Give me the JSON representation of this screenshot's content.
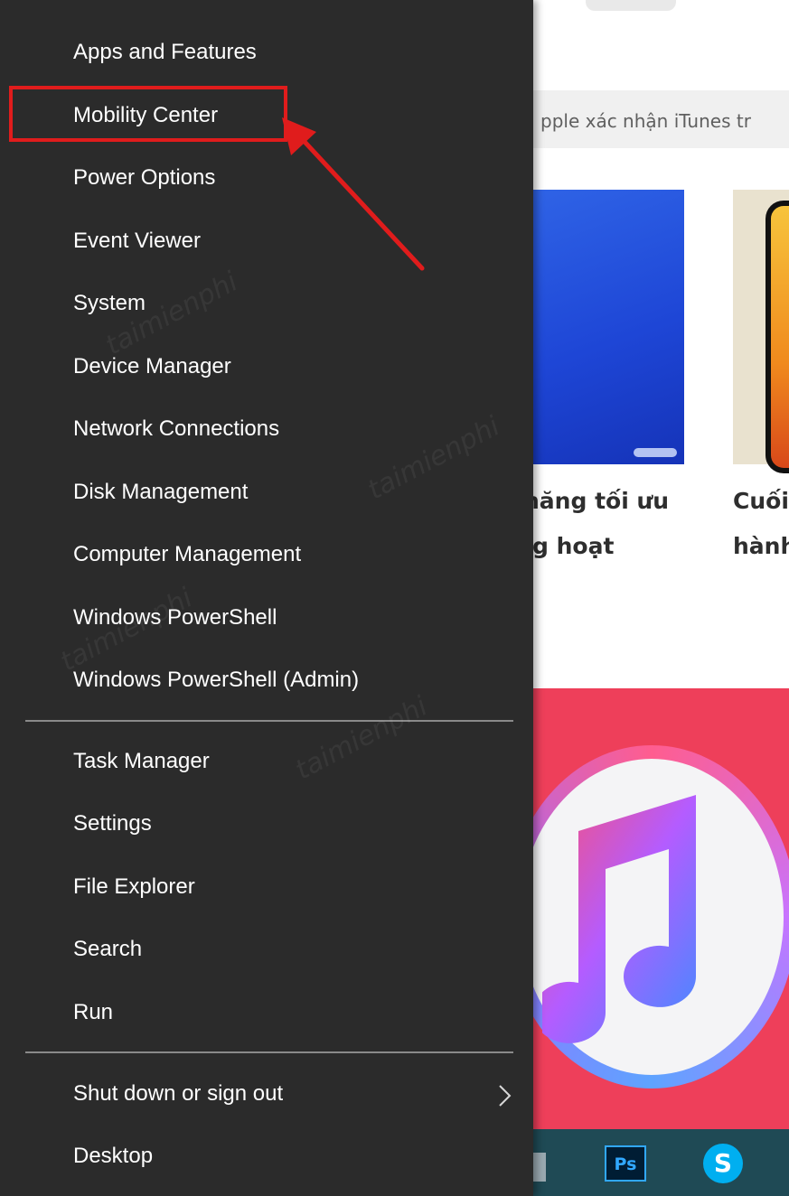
{
  "menu": {
    "items": [
      {
        "label": "Apps and Features",
        "name": "menu-item-apps-and-features"
      },
      {
        "label": "Mobility Center",
        "name": "menu-item-mobility-center"
      },
      {
        "label": "Power Options",
        "name": "menu-item-power-options"
      },
      {
        "label": "Event Viewer",
        "name": "menu-item-event-viewer"
      },
      {
        "label": "System",
        "name": "menu-item-system"
      },
      {
        "label": "Device Manager",
        "name": "menu-item-device-manager"
      },
      {
        "label": "Network Connections",
        "name": "menu-item-network-connections"
      },
      {
        "label": "Disk Management",
        "name": "menu-item-disk-management"
      },
      {
        "label": "Computer Management",
        "name": "menu-item-computer-management"
      },
      {
        "label": "Windows PowerShell",
        "name": "menu-item-windows-powershell"
      },
      {
        "label": "Windows PowerShell (Admin)",
        "name": "menu-item-windows-powershell-admin"
      },
      {
        "label": "Task Manager",
        "name": "menu-item-task-manager"
      },
      {
        "label": "Settings",
        "name": "menu-item-settings"
      },
      {
        "label": "File Explorer",
        "name": "menu-item-file-explorer"
      },
      {
        "label": "Search",
        "name": "menu-item-search"
      },
      {
        "label": "Run",
        "name": "menu-item-run"
      },
      {
        "label": "Shut down or sign out",
        "name": "menu-item-shut-down-or-sign-out"
      },
      {
        "label": "Desktop",
        "name": "menu-item-desktop"
      }
    ],
    "highlighted": "Mobility Center"
  },
  "background": {
    "search_text": "pple xác nhận iTunes tr",
    "card1_title_line1": "năng tối ưu",
    "card1_title_line2": "g hoạt",
    "card2_title_line1": "Cuối",
    "card2_title_line2": "hành",
    "taskbar_ps_label": "Ps",
    "taskbar_skype_label": "S"
  },
  "colors": {
    "menu_bg": "#2b2b2b",
    "menu_text": "#ffffff",
    "highlight_red": "#e01c1c",
    "hero_bg": "#ee3f5a"
  },
  "icons": [
    "chevron-right-icon",
    "red-arrow-annotation",
    "photoshop-icon",
    "skype-icon",
    "itunes-logo"
  ]
}
